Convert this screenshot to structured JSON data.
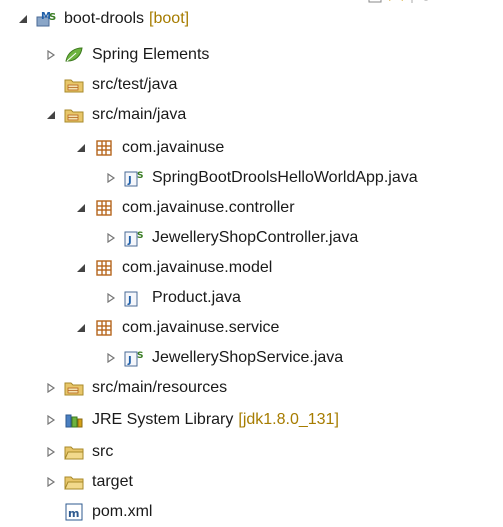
{
  "tree": {
    "project": {
      "label": "boot-drools",
      "decoration": "[boot]",
      "icon": "boot-project-icon",
      "expanded": true
    },
    "spring_elements": {
      "label": "Spring Elements",
      "icon": "spring-leaf-icon"
    },
    "src_test_java": {
      "label": "src/test/java",
      "icon": "source-folder-icon"
    },
    "src_main_java": {
      "label": "src/main/java",
      "icon": "source-folder-icon",
      "expanded": true
    },
    "packages": [
      {
        "label": "com.javainuse",
        "icon": "package-icon",
        "file": {
          "label": "SpringBootDroolsHelloWorldApp.java",
          "icon": "spring-java-file-icon"
        }
      },
      {
        "label": "com.javainuse.controller",
        "icon": "package-icon",
        "file": {
          "label": "JewelleryShopController.java",
          "icon": "spring-java-file-icon"
        }
      },
      {
        "label": "com.javainuse.model",
        "icon": "package-icon",
        "file": {
          "label": "Product.java",
          "icon": "java-file-icon"
        }
      },
      {
        "label": "com.javainuse.service",
        "icon": "package-icon",
        "file": {
          "label": "JewelleryShopService.java",
          "icon": "spring-java-file-icon"
        }
      }
    ],
    "src_main_resources": {
      "label": "src/main/resources",
      "icon": "source-folder-icon"
    },
    "jre": {
      "label": "JRE System Library",
      "decoration": "[jdk1.8.0_131]",
      "icon": "library-icon"
    },
    "src": {
      "label": "src",
      "icon": "folder-icon"
    },
    "target": {
      "label": "target",
      "icon": "folder-icon"
    },
    "pom": {
      "label": "pom.xml",
      "icon": "maven-file-icon"
    }
  },
  "colors": {
    "decoration": "#a67c00",
    "package": "#b5651d",
    "folder": "#e8c66a",
    "leaf": "#6db33f"
  }
}
